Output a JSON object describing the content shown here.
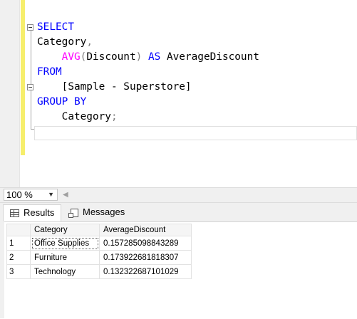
{
  "editor": {
    "lines": [
      {
        "parts": [
          {
            "t": "SELECT",
            "c": "kw"
          }
        ]
      },
      {
        "parts": [
          {
            "t": "Category",
            "c": ""
          },
          {
            "t": ",",
            "c": "gray"
          }
        ]
      },
      {
        "parts": [
          {
            "t": "    ",
            "c": ""
          },
          {
            "t": "AVG",
            "c": "fn"
          },
          {
            "t": "(",
            "c": "gray"
          },
          {
            "t": "Discount",
            "c": ""
          },
          {
            "t": ")",
            "c": "gray"
          },
          {
            "t": " AS ",
            "c": "kw"
          },
          {
            "t": "AverageDiscount",
            "c": ""
          }
        ]
      },
      {
        "parts": [
          {
            "t": "FROM",
            "c": "kw"
          }
        ]
      },
      {
        "parts": [
          {
            "t": "    [Sample - Superstore]",
            "c": ""
          }
        ]
      },
      {
        "parts": [
          {
            "t": "GROUP BY",
            "c": "kw"
          }
        ]
      },
      {
        "parts": [
          {
            "t": "    Category",
            "c": ""
          },
          {
            "t": ";",
            "c": "gray"
          }
        ]
      },
      {
        "parts": [
          {
            "t": "",
            "c": ""
          }
        ]
      }
    ]
  },
  "zoom": {
    "value": "100 %",
    "chevron_icon": "chevron-down-icon",
    "scroll_left_icon": "triangle-left-icon"
  },
  "tabs": {
    "results": {
      "label": "Results",
      "icon": "grid-icon"
    },
    "messages": {
      "label": "Messages",
      "icon": "messages-icon"
    }
  },
  "results_grid": {
    "columns": [
      "Category",
      "AverageDiscount"
    ],
    "rows": [
      {
        "num": "1",
        "category": "Office Supplies",
        "avg": "0.157285098843289"
      },
      {
        "num": "2",
        "category": "Furniture",
        "avg": "0.173922681818307"
      },
      {
        "num": "3",
        "category": "Technology",
        "avg": "0.132322687101029"
      }
    ]
  },
  "colors": {
    "keyword": "#0000ff",
    "function": "#ff00ff",
    "punctuation": "#808080",
    "change_bar": "#f6ee6b"
  }
}
